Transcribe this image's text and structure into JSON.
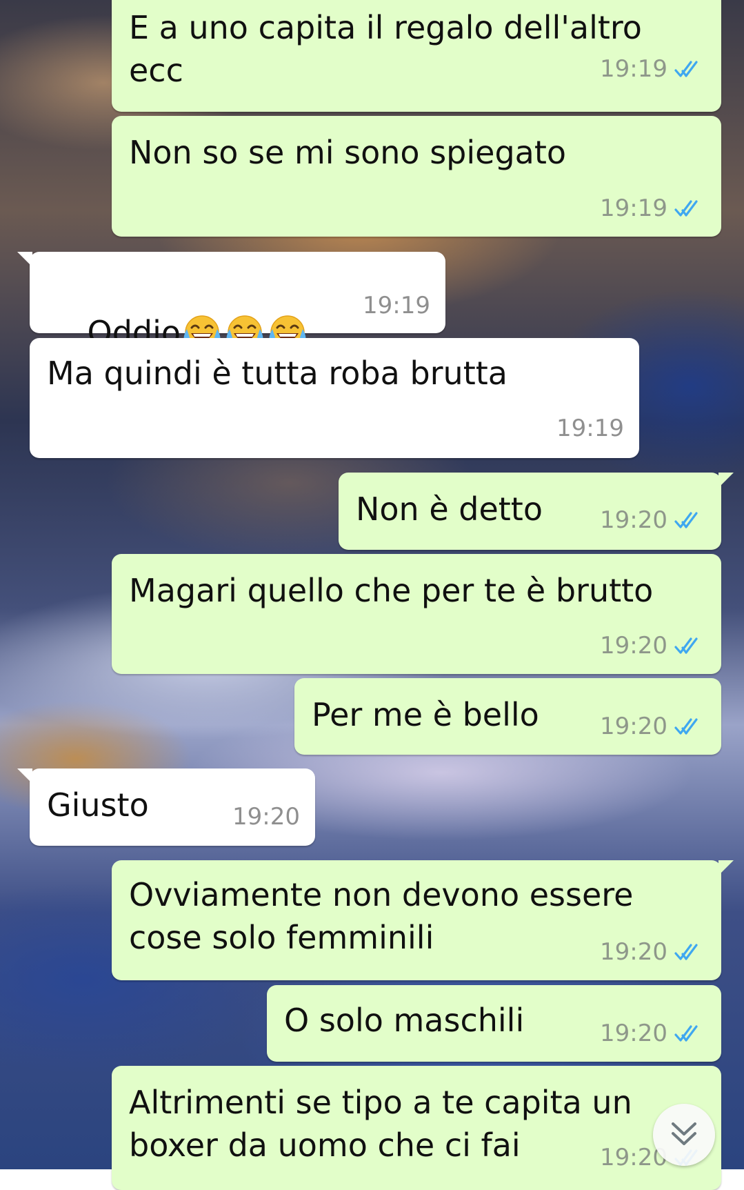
{
  "chat": {
    "messages": [
      {
        "text": "E a uno capita il regalo dell'altro\necc",
        "time": "19:19"
      },
      {
        "text": "Non so se mi sono spiegato",
        "time": "19:19"
      },
      {
        "text": "Oddio",
        "time": "19:19",
        "emoji": "face-with-tears-of-joy-icon",
        "emoji_count": 3
      },
      {
        "text": "Ma quindi è tutta roba brutta",
        "time": "19:19"
      },
      {
        "text": "Non è detto",
        "time": "19:20"
      },
      {
        "text": "Magari quello che per te è brutto",
        "time": "19:20"
      },
      {
        "text": "Per me è bello",
        "time": "19:20"
      },
      {
        "text": "Giusto",
        "time": "19:20"
      },
      {
        "text": "Ovviamente non devono essere\ncose solo femminili",
        "time": "19:20"
      },
      {
        "text": "O solo maschili",
        "time": "19:20"
      },
      {
        "text": "Altrimenti se tipo a te capita un\nboxer da uomo che ci fai",
        "time": "19:20"
      }
    ]
  },
  "icons": {
    "read_receipt": "double-check-icon",
    "scroll_down": "chevron-double-down-icon"
  },
  "colors": {
    "outgoing_bubble": "#e2fec9",
    "incoming_bubble": "#ffffff",
    "read_tick": "#3fa7f0",
    "timestamp": "#8e978a"
  }
}
